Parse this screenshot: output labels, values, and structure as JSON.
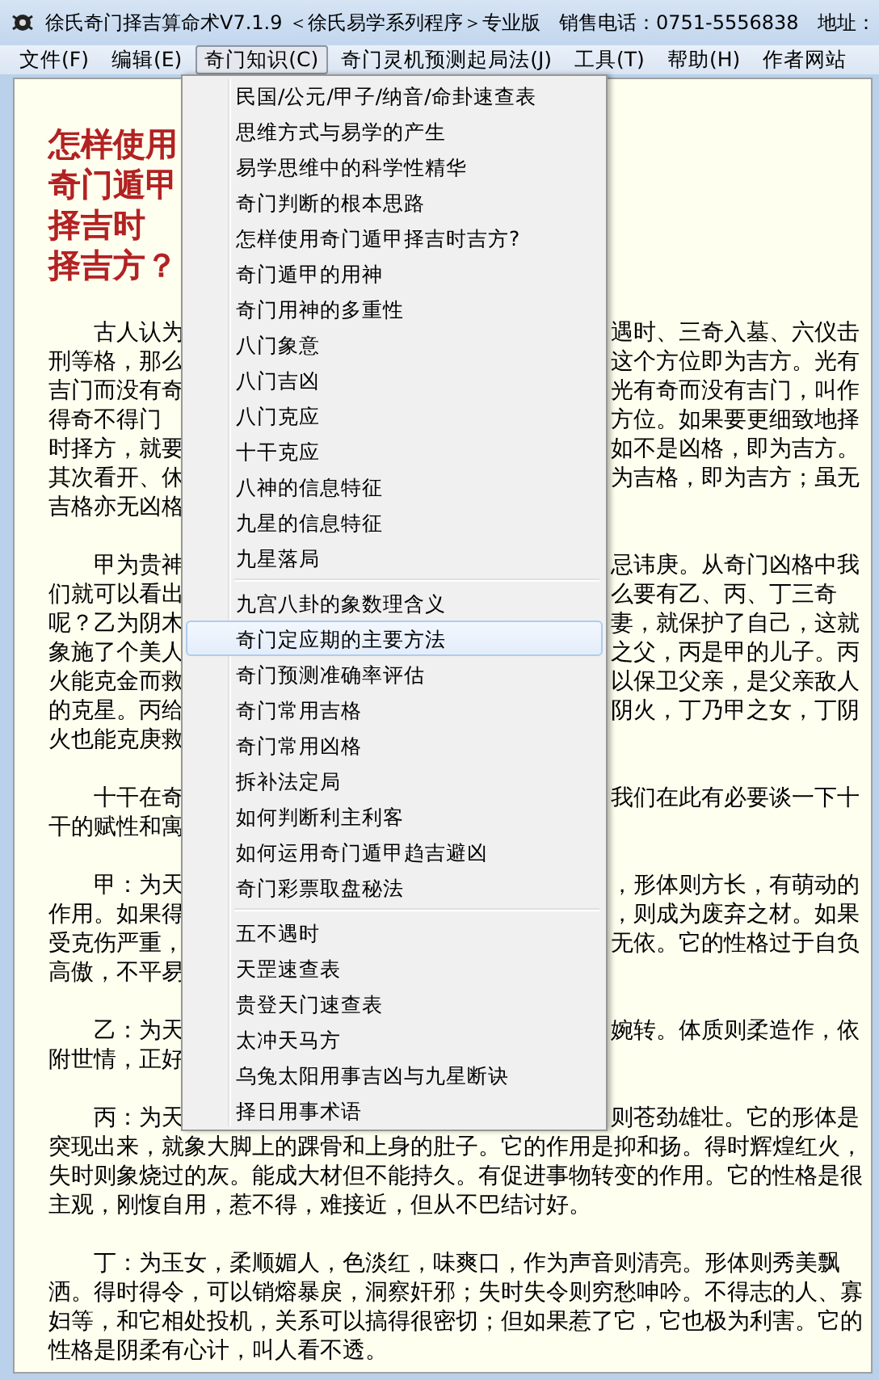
{
  "window": {
    "title": "徐氏奇门择吉算命术V7.1.9 ＜徐氏易学系列程序＞专业版   销售电话：0751-5556838   地址："
  },
  "menubar": [
    {
      "label": "文件(F)",
      "selected": false
    },
    {
      "label": "编辑(E)",
      "selected": false
    },
    {
      "label": "奇门知识(C)",
      "selected": true
    },
    {
      "label": "奇门灵机预测起局法(J)",
      "selected": false
    },
    {
      "label": "工具(T)",
      "selected": false
    },
    {
      "label": "帮助(H)",
      "selected": false
    },
    {
      "label": "作者网站",
      "selected": false
    }
  ],
  "document": {
    "heading": [
      "怎样使用",
      "奇门遁甲",
      "择吉时",
      "择吉方？"
    ],
    "paragraphs": [
      {
        "lines": [
          {
            "left": "古人认为",
            "right": "遇时、三奇入墓、六仪击"
          },
          {
            "left": "刑等格，那么",
            "right": "这个方位即为吉方。光有"
          },
          {
            "left": "吉门而没有奇",
            "right": "光有奇而没有吉门，叫作"
          },
          {
            "left": "得奇不得门",
            "right": "方位。如果要更细致地择"
          },
          {
            "left": "时择方，就要",
            "right": "如不是凶格，即为吉方。"
          },
          {
            "left": "其次看开、休",
            "right": "为吉格，即为吉方；虽无"
          },
          {
            "left": "吉格亦无凶格"
          }
        ]
      },
      {
        "lines": [
          {
            "left": "甲为贵神",
            "right": "忌讳庚。从奇门凶格中我"
          },
          {
            "left": "们就可以看出",
            "right": "么要有乙、丙、丁三奇"
          },
          {
            "left": "呢？乙为阴木",
            "right": "妻，就保护了自己，这就"
          },
          {
            "left": "象施了个美人",
            "right": "之父，丙是甲的儿子。丙"
          },
          {
            "left": "火能克金而救",
            "right": "以保卫父亲，是父亲敌人"
          },
          {
            "left": "的克星。丙给",
            "right": "阴火，丁乃甲之女，丁阴"
          },
          {
            "left": "火也能克庚救"
          }
        ]
      },
      {
        "lines": [
          {
            "left": "十干在奇",
            "right": "我们在此有必要谈一下十"
          },
          {
            "left": "干的赋性和寓"
          }
        ]
      },
      {
        "lines": [
          {
            "left": "甲：为天",
            "right": "，形体则方长，有萌动的"
          },
          {
            "left": "作用。如果得",
            "right": "，则成为废弃之材。如果"
          },
          {
            "left": "受克伤严重，",
            "right": "无依。它的性格过于自负"
          },
          {
            "left": "高傲，不平易"
          }
        ]
      },
      {
        "lines": [
          {
            "left": "乙：为天",
            "right": "婉转。体质则柔造作，依"
          },
          {
            "left": "附世情，正好"
          }
        ]
      },
      {
        "lines": [
          {
            "left": "丙：为天",
            "right": "则苍劲雄壮。它的形体是"
          },
          {
            "left": "突现出来，就象大脚上的踝骨和上身的肚子。它的作用是抑和扬。得时辉煌红火，"
          },
          {
            "left": "失时则象烧过的灰。能成大材但不能持久。有促进事物转变的作用。它的性格是很"
          },
          {
            "left": "主观，刚愎自用，惹不得，难接近，但从不巴结讨好。"
          }
        ]
      },
      {
        "lines": [
          {
            "left": "丁：为玉女，柔顺媚人，色淡红，味爽口，作为声音则清亮。形体则秀美飘"
          },
          {
            "left": "洒。得时得令，可以销熔暴戾，洞察奸邪；失时失令则穷愁呻吟。不得志的人、寡"
          },
          {
            "left": "妇等，和它相处投机，关系可以搞得很密切；但如果惹了它，它也极为利害。它的"
          },
          {
            "left": "性格是阴柔有心计，叫人看不透。"
          }
        ]
      }
    ]
  },
  "menu": {
    "groups": [
      {
        "items": [
          {
            "label": "民国/公元/甲子/纳音/命卦速查表",
            "selected": false
          },
          {
            "label": "思维方式与易学的产生",
            "selected": false
          },
          {
            "label": "易学思维中的科学性精华",
            "selected": false
          },
          {
            "label": "奇门判断的根本思路",
            "selected": false
          },
          {
            "label": "怎样使用奇门遁甲择吉时吉方?",
            "selected": false
          },
          {
            "label": "奇门遁甲的用神",
            "selected": false
          },
          {
            "label": "奇门用神的多重性",
            "selected": false
          },
          {
            "label": "八门象意",
            "selected": false
          },
          {
            "label": "八门吉凶",
            "selected": false
          },
          {
            "label": "八门克应",
            "selected": false
          },
          {
            "label": "十干克应",
            "selected": false
          },
          {
            "label": "八神的信息特征",
            "selected": false
          },
          {
            "label": "九星的信息特征",
            "selected": false
          },
          {
            "label": "九星落局",
            "selected": false
          }
        ]
      },
      {
        "items": [
          {
            "label": "九宫八卦的象数理含义",
            "selected": false
          },
          {
            "label": "奇门定应期的主要方法",
            "selected": true
          },
          {
            "label": "奇门预测准确率评估",
            "selected": false
          },
          {
            "label": "奇门常用吉格",
            "selected": false
          },
          {
            "label": "奇门常用凶格",
            "selected": false
          },
          {
            "label": "拆补法定局",
            "selected": false
          },
          {
            "label": "如何判断利主利客",
            "selected": false
          },
          {
            "label": "如何运用奇门遁甲趋吉避凶",
            "selected": false
          },
          {
            "label": "奇门彩票取盘秘法",
            "selected": false
          }
        ]
      },
      {
        "items": [
          {
            "label": "五不遇时",
            "selected": false
          },
          {
            "label": "天罡速查表",
            "selected": false
          },
          {
            "label": "贵登天门速查表",
            "selected": false
          },
          {
            "label": "太冲天马方",
            "selected": false
          },
          {
            "label": "乌兔太阳用事吉凶与九星断诀",
            "selected": false
          },
          {
            "label": "择日用事术语",
            "selected": false
          }
        ]
      }
    ]
  }
}
